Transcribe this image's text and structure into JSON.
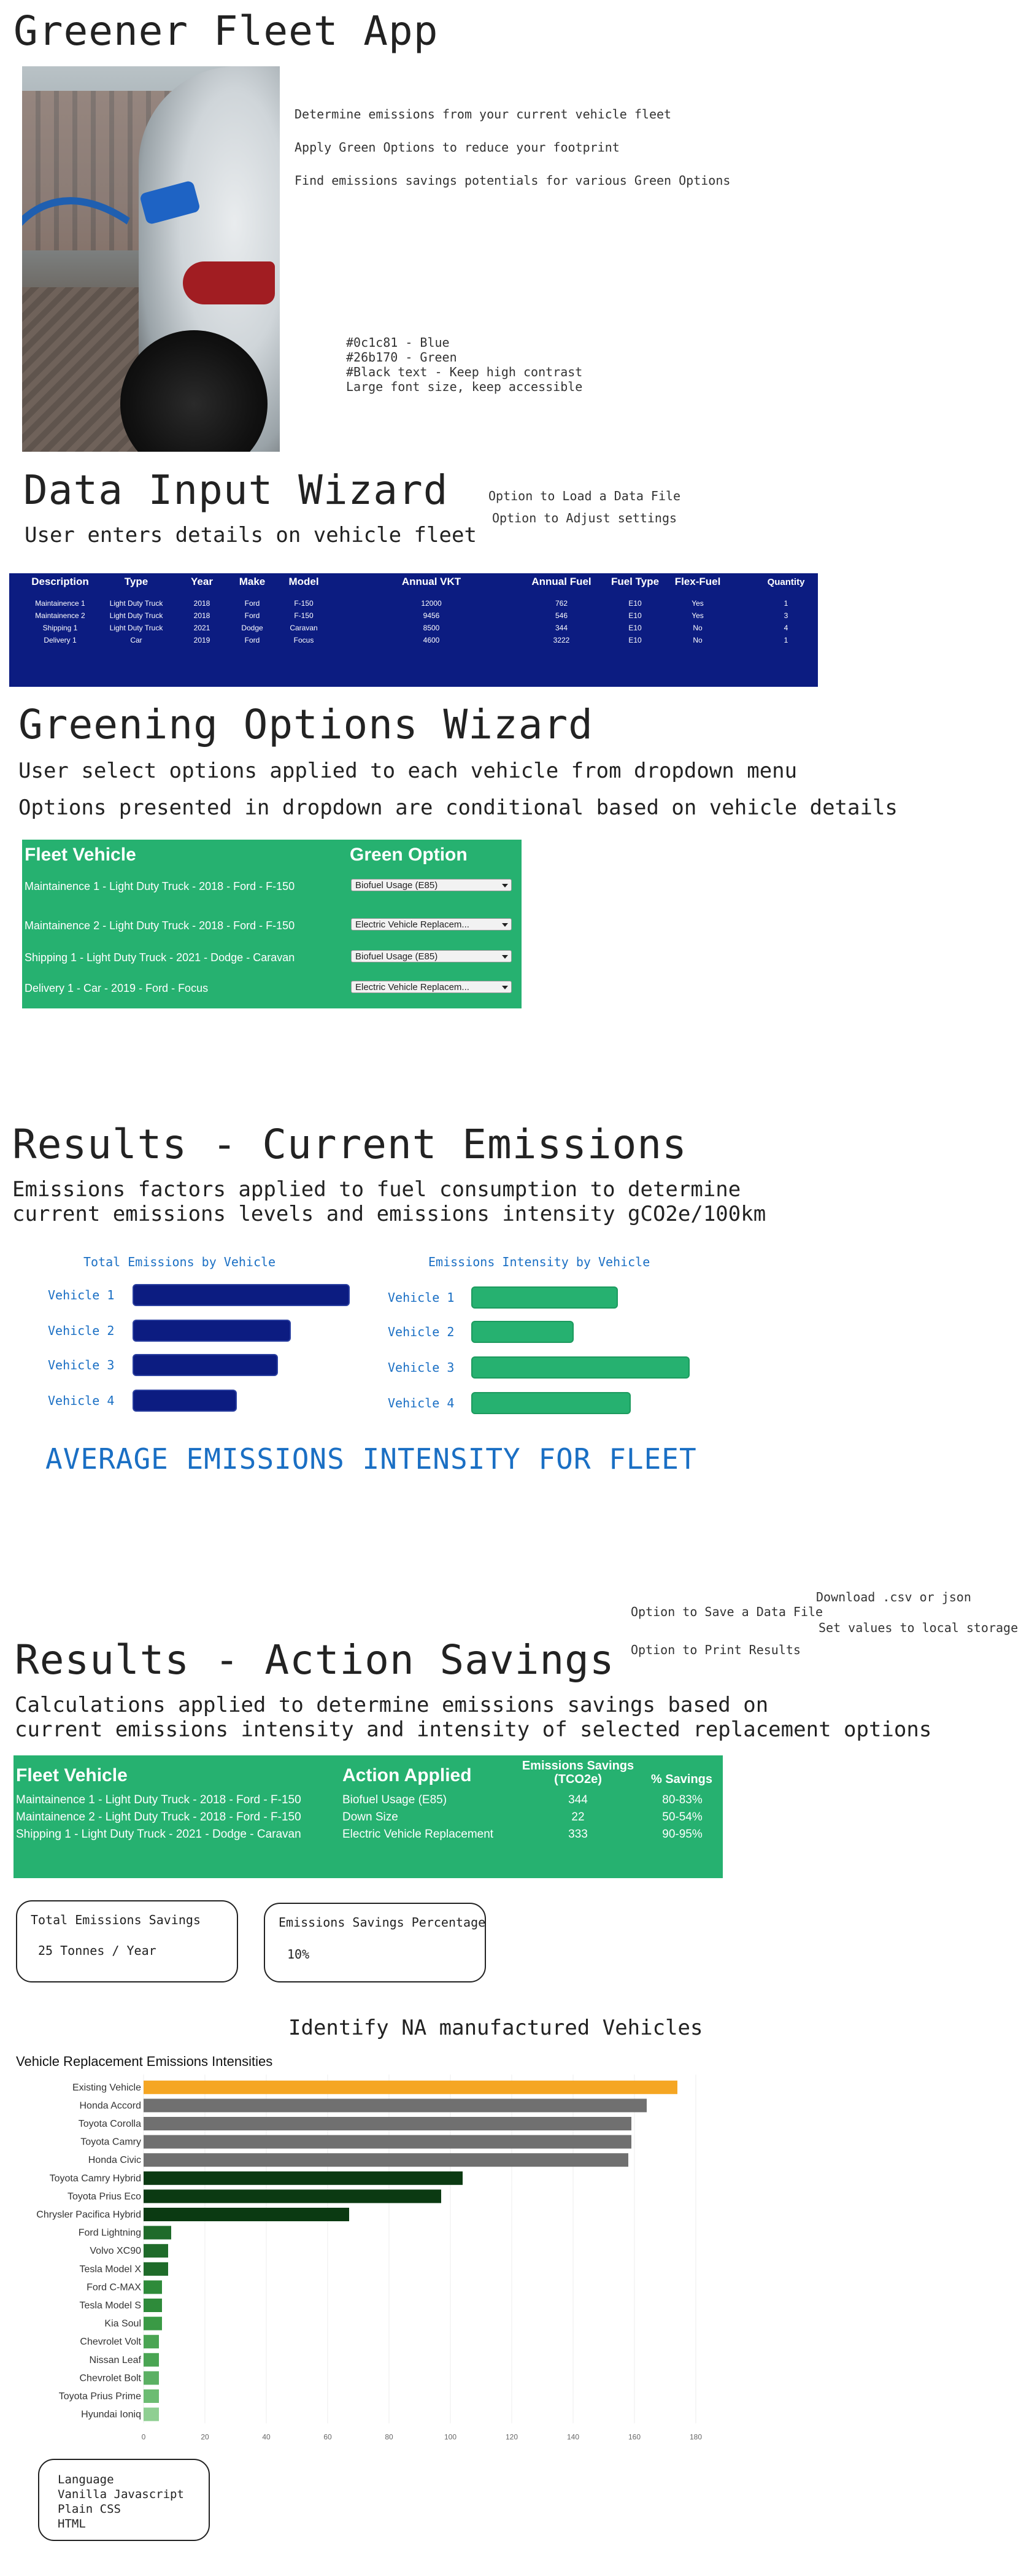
{
  "app": {
    "title": "Greener Fleet App",
    "intro_lines": [
      "Determine emissions from your current vehicle fleet",
      "Apply Green Options to reduce your footprint",
      "Find emissions savings potentials for various Green Options"
    ],
    "style_notes": [
      "#0c1c81 - Blue",
      "#26b170 - Green",
      "#Black text - Keep high contrast",
      "Large font size, keep accessible"
    ]
  },
  "colors": {
    "blue": "#0c1c81",
    "green": "#26b170",
    "accent_text": "#1a6fc4",
    "highlight": "#f5a623"
  },
  "data_input": {
    "title": "Data Input Wizard",
    "subtitle": "User enters details on vehicle fleet",
    "note_load": "Option to Load a Data File",
    "note_adjust": "Option to Adjust settings",
    "headers": [
      "Description",
      "Type",
      "Year",
      "Make",
      "Model",
      "Annual VKT",
      "Annual Fuel",
      "Fuel Type",
      "Flex-Fuel",
      "Quantity"
    ],
    "rows": [
      [
        "Maintainence 1",
        "Light Duty Truck",
        "2018",
        "Ford",
        "F-150",
        "12000",
        "762",
        "E10",
        "Yes",
        "1"
      ],
      [
        "Maintainence 2",
        "Light Duty Truck",
        "2018",
        "Ford",
        "F-150",
        "9456",
        "546",
        "E10",
        "Yes",
        "3"
      ],
      [
        "Shipping 1",
        "Light Duty Truck",
        "2021",
        "Dodge",
        "Caravan",
        "8500",
        "344",
        "E10",
        "No",
        "4"
      ],
      [
        "Delivery 1",
        "Car",
        "2019",
        "Ford",
        "Focus",
        "4600",
        "3222",
        "E10",
        "No",
        "1"
      ]
    ]
  },
  "greening": {
    "title": "Greening Options Wizard",
    "subtitle1": "User select options applied to each vehicle from dropdown menu",
    "subtitle2": "Options presented in dropdown are conditional based on vehicle details",
    "col_vehicle": "Fleet Vehicle",
    "col_option": "Green Option",
    "rows": [
      {
        "vehicle": "Maintainence 1  - Light Duty Truck - 2018 - Ford - F-150",
        "option": "Biofuel Usage (E85)"
      },
      {
        "vehicle": "Maintainence 2 - Light Duty Truck - 2018 - Ford - F-150",
        "option": "Electric Vehicle Replacem..."
      },
      {
        "vehicle": "Shipping 1 - Light Duty Truck - 2021 - Dodge - Caravan",
        "option": "Biofuel Usage (E85)"
      },
      {
        "vehicle": "Delivery 1 - Car - 2019 - Ford - Focus",
        "option": "Electric Vehicle Replacem..."
      }
    ]
  },
  "current": {
    "title": "Results - Current Emissions",
    "desc1": "Emissions factors applied to fuel consumption to determine",
    "desc2": "current emissions levels and emissions intensity gCO2e/100km",
    "chart1_title": "Total Emissions by Vehicle",
    "chart2_title": "Emissions Intensity by Vehicle",
    "vehicles": [
      "Vehicle 1",
      "Vehicle 2",
      "Vehicle 3",
      "Vehicle 4"
    ],
    "total_rel": [
      1.0,
      0.73,
      0.67,
      0.48
    ],
    "intensity_rel": [
      0.67,
      0.47,
      1.0,
      0.73
    ],
    "avg_label": "AVERAGE EMISSIONS INTENSITY FOR FLEET"
  },
  "savings": {
    "note_download": "Download .csv or json",
    "note_save": "Option to Save a Data File",
    "note_local": "Set values to local storage",
    "note_print": "Option to Print Results",
    "title": "Results - Action Savings",
    "desc1": "Calculations applied to determine emissions savings based on",
    "desc2": "current emissions intensity and intensity of selected replacement options",
    "col_vehicle": "Fleet Vehicle",
    "col_action": "Action Applied",
    "col_savings": "Emissions Savings",
    "col_savings_unit": "(TCO2e)",
    "col_pct": "% Savings",
    "rows": [
      [
        "Maintainence 1  - Light Duty Truck - 2018 - Ford - F-150",
        "Biofuel Usage (E85)",
        "344",
        "80-83%"
      ],
      [
        "Maintainence 2 - Light Duty Truck - 2018 - Ford - F-150",
        "Down Size",
        "22",
        "50-54%"
      ],
      [
        "Shipping 1 - Light Duty Truck - 2021 - Dodge - Caravan",
        "Electric Vehicle Replacement",
        "333",
        "90-95%"
      ]
    ],
    "total_title": "Total Emissions Savings",
    "total_value": "25 Tonnes / Year",
    "pct_title": "Emissions Savings Percentage",
    "pct_value": "10%"
  },
  "na_title": "Identify NA manufactured Vehicles",
  "chart_data": {
    "type": "bar",
    "orientation": "horizontal",
    "title": "Vehicle Replacement Emissions Intensities",
    "categories": [
      "Existing Vehicle",
      "Honda Accord",
      "Toyota Corolla",
      "Toyota Camry",
      "Honda Civic",
      "Toyota Camry Hybrid",
      "Toyota Prius Eco",
      "Chrysler Pacifica Hybrid",
      "Ford Lightning",
      "Volvo XC90",
      "Tesla Model X",
      "Ford C-MAX",
      "Tesla Model S",
      "Kia Soul",
      "Chevrolet Volt",
      "Nissan Leaf",
      "Chevrolet Bolt",
      "Toyota Prius Prime",
      "Hyundai Ioniq"
    ],
    "values": [
      174,
      164,
      159,
      159,
      158,
      104,
      97,
      67,
      9,
      8,
      8,
      6,
      6,
      6,
      5,
      5,
      5,
      5,
      5
    ],
    "colors": [
      "#f5a623",
      "#707070",
      "#707070",
      "#707070",
      "#707070",
      "#0b3a12",
      "#0b3a12",
      "#0b3a12",
      "#1f6b2a",
      "#1f6b2a",
      "#1f6b2a",
      "#2e8b3a",
      "#2e8b3a",
      "#3a9a45",
      "#4aa553",
      "#4aa553",
      "#5bb063",
      "#6cbc72",
      "#8fcf92"
    ],
    "xlim": [
      0,
      180
    ],
    "xticks": [
      "0",
      "20",
      "40",
      "60",
      "80",
      "100",
      "120",
      "140",
      "160",
      "180"
    ],
    "grid": true
  },
  "tech": {
    "lines": [
      "Language",
      "Vanilla Javascript",
      "Plain CSS",
      "HTML"
    ]
  }
}
